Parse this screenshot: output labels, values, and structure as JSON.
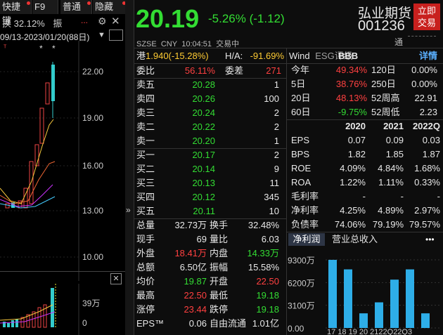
{
  "left_panel": {
    "tabs": [
      "快捷键",
      "F9",
      "普通",
      "隐藏"
    ],
    "change_row": {
      "label1": "换",
      "value": "32.12%",
      "label2": "振",
      "more": "..."
    },
    "date_range": "09/13-2023/01/20(88日)",
    "price_ticks": [
      "22.00",
      "19.00",
      "16.00",
      "13.00",
      "10.00"
    ],
    "volume_ticks": [
      "39万",
      "0"
    ],
    "markers": [
      "*",
      "*"
    ]
  },
  "header": {
    "price": "20.19",
    "change": "-5.26% (-1.12)",
    "market": "SZSE",
    "currency": "CNY",
    "time": "10:04:51",
    "status": "交易中",
    "name": "弘业期货",
    "code": "001236",
    "trade_button": "立即\n交易",
    "trade_line1": "立即",
    "trade_line2": "交易",
    "tong": "通"
  },
  "hk_row": {
    "label": "港",
    "value": "1.940(-15.28%)",
    "ha_label": "H/A:",
    "ha_value": "-91.69%"
  },
  "order_book": {
    "wb_label": "委比",
    "wb_value": "56.11%",
    "wc_label": "委差",
    "wc_value": "271",
    "asks": [
      {
        "label": "卖五",
        "price": "20.28",
        "vol": "1"
      },
      {
        "label": "卖四",
        "price": "20.26",
        "vol": "100"
      },
      {
        "label": "卖三",
        "price": "20.24",
        "vol": "2"
      },
      {
        "label": "卖二",
        "price": "20.22",
        "vol": "2"
      },
      {
        "label": "卖一",
        "price": "20.20",
        "vol": "1"
      }
    ],
    "bids": [
      {
        "label": "买一",
        "price": "20.17",
        "vol": "2"
      },
      {
        "label": "买二",
        "price": "20.14",
        "vol": "9"
      },
      {
        "label": "买三",
        "price": "20.13",
        "vol": "11"
      },
      {
        "label": "买四",
        "price": "20.12",
        "vol": "345"
      },
      {
        "label": "买五",
        "price": "20.11",
        "vol": "10"
      }
    ]
  },
  "stats": [
    {
      "l1": "总量",
      "v1": "32.73万",
      "c1": "white",
      "l2": "换手",
      "v2": "32.48%",
      "c2": "white"
    },
    {
      "l1": "现手",
      "v1": "69",
      "c1": "white",
      "l2": "量比",
      "v2": "6.03",
      "c2": "white"
    },
    {
      "l1": "外盘",
      "v1": "18.41万",
      "c1": "red",
      "l2": "内盘",
      "v2": "14.33万",
      "c2": "green"
    },
    {
      "l1": "总额",
      "v1": "6.50亿",
      "c1": "white",
      "l2": "振幅",
      "v2": "15.58%",
      "c2": "white"
    },
    {
      "l1": "均价",
      "v1": "19.87",
      "c1": "green",
      "l2": "开盘",
      "v2": "22.50",
      "c2": "red"
    },
    {
      "l1": "最高",
      "v1": "22.50",
      "c1": "red",
      "l2": "最低",
      "v2": "19.18",
      "c2": "green"
    },
    {
      "l1": "涨停",
      "v1": "23.44",
      "c1": "red",
      "l2": "跌停",
      "v2": "19.18",
      "c2": "green"
    },
    {
      "l1": "EPS™",
      "v1": "0.06",
      "c1": "white",
      "l2": "自由流通",
      "v2": "1.01亿",
      "c2": "white"
    }
  ],
  "perf": {
    "wind_label": "Wind",
    "esg_label": "ESG评级",
    "esg_value": "BBB",
    "detail": "详情",
    "rows": [
      {
        "l1": "今年",
        "v1": "49.34%",
        "c1": "red",
        "l2": "120日",
        "v2": "0.00%"
      },
      {
        "l1": "5日",
        "v1": "38.76%",
        "c1": "red",
        "l2": "250日",
        "v2": "0.00%"
      },
      {
        "l1": "20日",
        "v1": "48.13%",
        "c1": "red",
        "l2": "52周高",
        "v2": "22.91"
      },
      {
        "l1": "60日",
        "v1": "-9.75%",
        "c1": "green",
        "l2": "52周低",
        "v2": "2.23"
      }
    ]
  },
  "fin": {
    "years": [
      "2020",
      "2021",
      "2022Q"
    ],
    "rows": [
      {
        "label": "EPS",
        "vals": [
          "0.07",
          "0.09",
          "0.03"
        ]
      },
      {
        "label": "BPS",
        "vals": [
          "1.82",
          "1.85",
          "1.87"
        ]
      },
      {
        "label": "ROE",
        "vals": [
          "4.09%",
          "4.84%",
          "1.68%"
        ]
      },
      {
        "label": "ROA",
        "vals": [
          "1.22%",
          "1.11%",
          "0.33%"
        ]
      },
      {
        "label": "毛利率",
        "vals": [
          "-",
          "-",
          "-"
        ]
      },
      {
        "label": "净利率",
        "vals": [
          "4.25%",
          "4.89%",
          "2.97%"
        ]
      },
      {
        "label": "负债率",
        "vals": [
          "74.06%",
          "79.19%",
          "79.57%"
        ]
      }
    ]
  },
  "profit_tabs": {
    "tab1": "净利润",
    "tab2": "营业总收入",
    "more": "•••"
  },
  "chart_data": {
    "type": "bar",
    "yticks": [
      "9300万",
      "6200万",
      "3100万",
      "0.00"
    ],
    "ylim": [
      0,
      9300
    ],
    "series": [
      {
        "name": "净利润",
        "values": [
          9300,
          8000,
          2000,
          3500,
          6600,
          8000,
          2000
        ]
      }
    ],
    "categories": [
      "17",
      "18",
      "19",
      "20",
      "21",
      "22",
      "23"
    ],
    "xlabel_text": "17 18 19 20 2122Q22Q3"
  }
}
